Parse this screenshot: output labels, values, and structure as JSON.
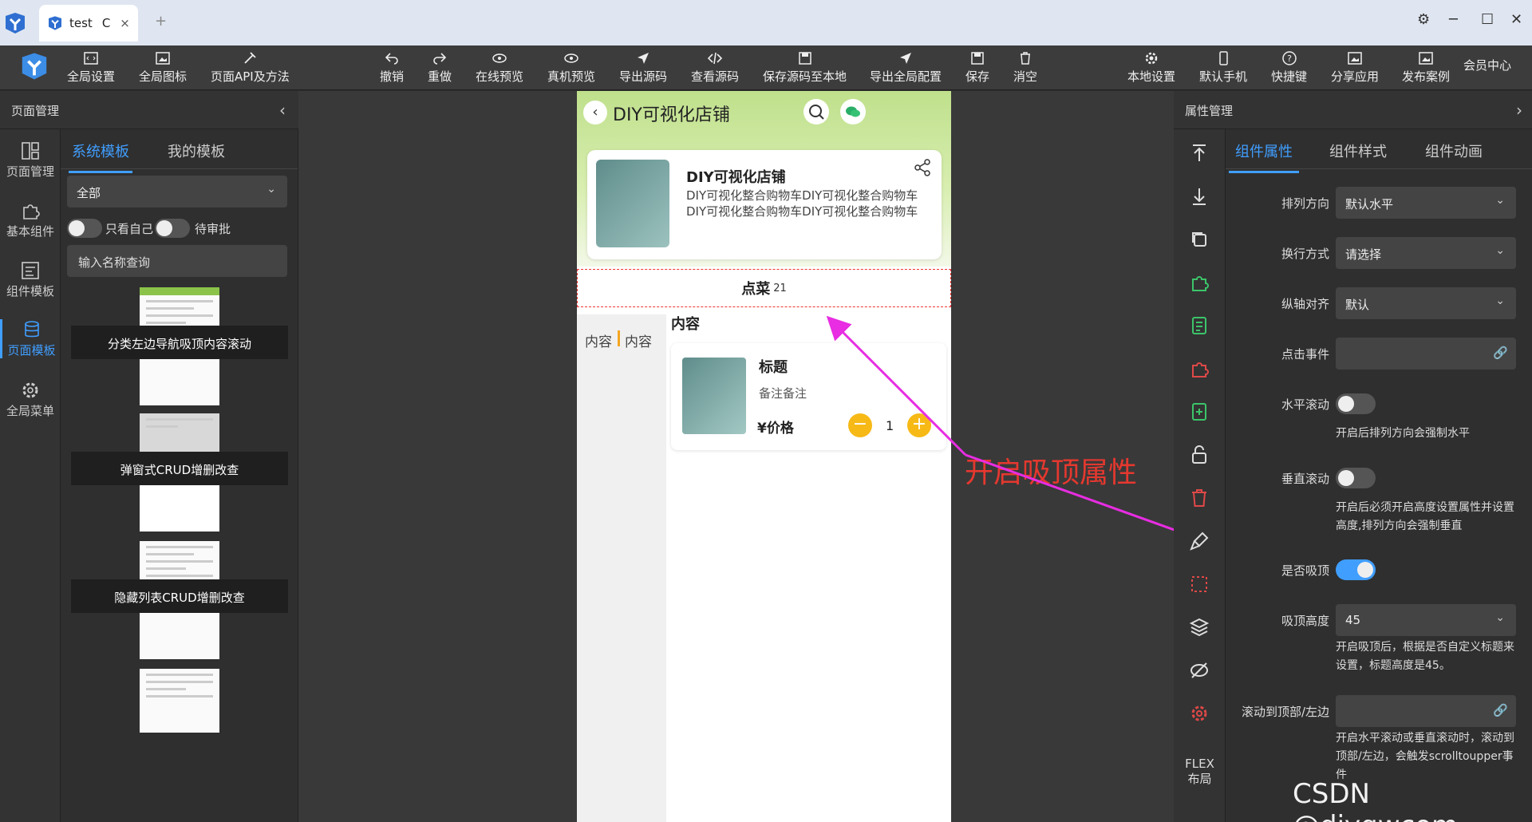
{
  "tabbar": {
    "tab_title": "test",
    "refresh_icon": "C",
    "close_icon": "×",
    "new_tab": "+"
  },
  "toolbar": {
    "left": [
      "全局设置",
      "全局图标",
      "页面API及方法"
    ],
    "center": [
      "撤销",
      "重做",
      "在线预览",
      "真机预览",
      "导出源码",
      "查看源码",
      "保存源码至本地",
      "导出全局配置",
      "保存",
      "消空"
    ],
    "right": [
      "本地设置",
      "默认手机",
      "快捷键",
      "分享应用",
      "发布案例",
      "会员中心"
    ]
  },
  "leftnav": {
    "header": "页面管理",
    "items": [
      "页面管理",
      "基本组件",
      "组件模板",
      "页面模板",
      "全局菜单"
    ],
    "active": "页面模板"
  },
  "leftpanel": {
    "tabs": [
      "系统模板",
      "我的模板"
    ],
    "filter_value": "全部",
    "toggle1_label": "只看自己",
    "toggle2_label": "待审批",
    "search_placeholder": "输入名称查询",
    "templates": [
      "分类左边导航吸顶内容滚动",
      "弹窗式CRUD增删改查",
      "隐藏列表CRUD增删改查"
    ]
  },
  "phone": {
    "title": "DIY可视化店铺",
    "card_title": "DIY可视化店铺",
    "card_desc": "DIY可视化整合购物车DIY可视化整合购物车",
    "section_title": "点菜",
    "section_count": "21",
    "side_items": [
      "内容",
      "内容"
    ],
    "content_title": "内容",
    "product_title": "标题",
    "product_note": "备注备注",
    "product_price": "¥价格",
    "quantity": "1"
  },
  "annotation": "开启吸顶属性",
  "rightpanel": {
    "header": "属性管理",
    "tabs": [
      "组件属性",
      "组件样式",
      "组件动画"
    ],
    "direction_label": "排列方向",
    "direction_value": "默认水平",
    "wrap_label": "换行方式",
    "wrap_value": "请选择",
    "align_label": "纵轴对齐",
    "align_value": "默认",
    "click_label": "点击事件",
    "hscroll_label": "水平滚动",
    "hscroll_hint": "开启后排列方向会强制水平",
    "vscroll_label": "垂直滚动",
    "vscroll_hint": "开启后必须开启高度设置属性并设置高度,排列方向会强制垂直",
    "sticky_label": "是否吸顶",
    "sticky_height_label": "吸顶高度",
    "sticky_height_value": "45",
    "sticky_hint": "开启吸顶后，根据是否自定义标题来设置，标题高度是45。",
    "scroll_top_label": "滚动到顶部/左边",
    "scroll_top_hint": "开启水平滚动或垂直滚动时，滚动到顶部/左边，会触发scrolltoupper事件"
  },
  "flex_label_1": "FLEX",
  "flex_label_2": "布局",
  "watermark": "CSDN @diygwcom"
}
